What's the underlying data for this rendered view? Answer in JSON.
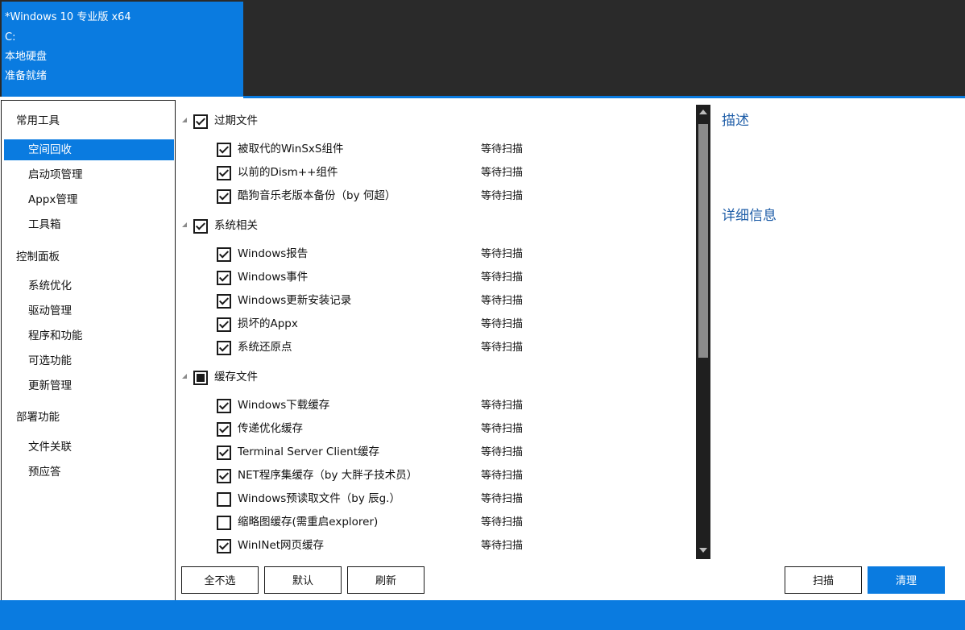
{
  "system_card": {
    "os": "*Windows 10 专业版 x64",
    "drive": "C:",
    "disk_type": "本地硬盘",
    "status": "准备就绪"
  },
  "sidebar": {
    "sections": [
      {
        "title": "常用工具",
        "items": [
          "空间回收",
          "启动项管理",
          "Appx管理",
          "工具箱"
        ]
      },
      {
        "title": "控制面板",
        "items": [
          "系统优化",
          "驱动管理",
          "程序和功能",
          "可选功能",
          "更新管理"
        ]
      },
      {
        "title": "部署功能",
        "items": [
          "文件关联",
          "预应答"
        ]
      }
    ],
    "selected": "空间回收"
  },
  "tree": {
    "groups": [
      {
        "label": "过期文件",
        "state": "checked",
        "items": [
          {
            "label": "被取代的WinSxS组件",
            "checked": true,
            "status": "等待扫描"
          },
          {
            "label": "以前的Dism++组件",
            "checked": true,
            "status": "等待扫描"
          },
          {
            "label": "酷狗音乐老版本备份（by 何超）",
            "checked": true,
            "status": "等待扫描"
          }
        ]
      },
      {
        "label": "系统相关",
        "state": "checked",
        "items": [
          {
            "label": "Windows报告",
            "checked": true,
            "status": "等待扫描"
          },
          {
            "label": "Windows事件",
            "checked": true,
            "status": "等待扫描"
          },
          {
            "label": "Windows更新安装记录",
            "checked": true,
            "status": "等待扫描"
          },
          {
            "label": "损坏的Appx",
            "checked": true,
            "status": "等待扫描"
          },
          {
            "label": "系统还原点",
            "checked": true,
            "status": "等待扫描"
          }
        ]
      },
      {
        "label": "缓存文件",
        "state": "partial",
        "items": [
          {
            "label": "Windows下载缓存",
            "checked": true,
            "status": "等待扫描"
          },
          {
            "label": "传递优化缓存",
            "checked": true,
            "status": "等待扫描"
          },
          {
            "label": "Terminal Server Client缓存",
            "checked": true,
            "status": "等待扫描"
          },
          {
            "label": "NET程序集缓存（by 大胖子技术员）",
            "checked": true,
            "status": "等待扫描"
          },
          {
            "label": "Windows预读取文件（by 辰g.）",
            "checked": false,
            "status": "等待扫描"
          },
          {
            "label": "缩略图缓存(需重启explorer)",
            "checked": false,
            "status": "等待扫描"
          },
          {
            "label": "WinINet网页缓存",
            "checked": true,
            "status": "等待扫描"
          }
        ]
      }
    ]
  },
  "info_panel": {
    "description_title": "描述",
    "details_title": "详细信息"
  },
  "buttons": {
    "deselect_all": "全不选",
    "default": "默认",
    "refresh": "刷新",
    "scan": "扫描",
    "clean": "清理"
  },
  "colors": {
    "accent": "#0a7be0",
    "header_dark": "#2a2a2a",
    "info_title": "#1f5ea8"
  }
}
